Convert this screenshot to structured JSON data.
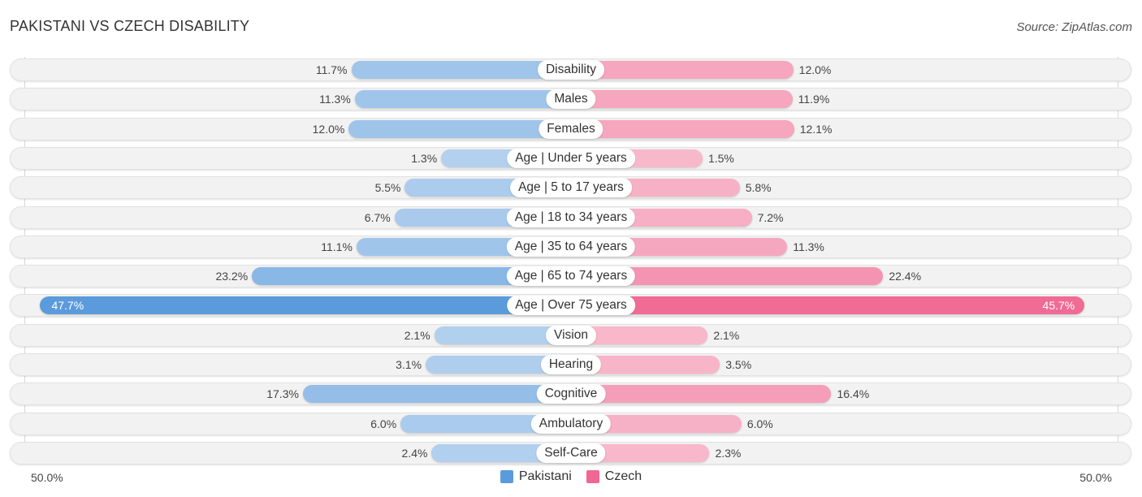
{
  "header": {
    "title": "PAKISTANI VS CZECH DISABILITY",
    "source": "Source: ZipAtlas.com"
  },
  "chart_data": {
    "type": "bar",
    "orientation": "horizontal-diverging",
    "title": "PAKISTANI VS CZECH DISABILITY",
    "categories": [
      "Disability",
      "Males",
      "Females",
      "Age | Under 5 years",
      "Age | 5 to 17 years",
      "Age | 18 to 34 years",
      "Age | 35 to 64 years",
      "Age | 65 to 74 years",
      "Age | Over 75 years",
      "Vision",
      "Hearing",
      "Cognitive",
      "Ambulatory",
      "Self-Care"
    ],
    "series": [
      {
        "name": "Pakistani",
        "color": "#5b9bdc",
        "values": [
          11.7,
          11.3,
          12.0,
          1.3,
          5.5,
          6.7,
          11.1,
          23.2,
          47.7,
          2.1,
          3.1,
          17.3,
          6.0,
          2.4
        ]
      },
      {
        "name": "Czech",
        "color": "#f06892",
        "values": [
          12.0,
          11.9,
          12.1,
          1.5,
          5.8,
          7.2,
          11.3,
          22.4,
          45.7,
          2.1,
          3.5,
          16.4,
          6.0,
          2.3
        ]
      }
    ],
    "value_labels": {
      "Pakistani": [
        "11.7%",
        "11.3%",
        "12.0%",
        "1.3%",
        "5.5%",
        "6.7%",
        "11.1%",
        "23.2%",
        "47.7%",
        "2.1%",
        "3.1%",
        "17.3%",
        "6.0%",
        "2.4%"
      ],
      "Czech": [
        "12.0%",
        "11.9%",
        "12.1%",
        "1.5%",
        "5.8%",
        "7.2%",
        "11.3%",
        "22.4%",
        "45.7%",
        "2.1%",
        "3.5%",
        "16.4%",
        "6.0%",
        "2.3%"
      ]
    },
    "xlim": [
      -50,
      50
    ],
    "axis_labels": {
      "left": "50.0%",
      "right": "50.0%"
    },
    "legend": {
      "position": "bottom-center",
      "entries": [
        "Pakistani",
        "Czech"
      ]
    },
    "grid": false
  }
}
